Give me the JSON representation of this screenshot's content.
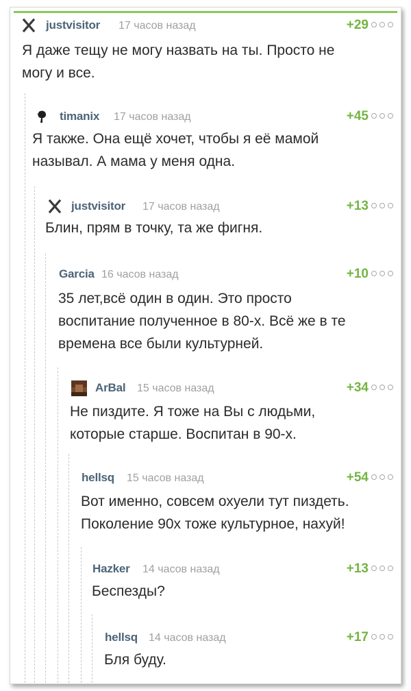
{
  "comments": [
    {
      "author": "justvisitor",
      "time": "17 часов назад",
      "rating": "+29",
      "text_lines": [
        "Я даже тещу не могу назвать на ты. Просто не",
        "могу и все."
      ],
      "avatar": "x-icon"
    },
    {
      "author": "timanix",
      "time": "17 часов назад",
      "rating": "+45",
      "text_lines": [
        "Я также. Она ещё хочет, чтобы я её мамой",
        "называл. А мама у меня одна."
      ],
      "avatar": "user-avatar-dark"
    },
    {
      "author": "justvisitor",
      "time": "17 часов назад",
      "rating": "+13",
      "text_lines": [
        "Блин, прям в точку, та же фигня."
      ],
      "avatar": "x-icon"
    },
    {
      "author": "Garcia",
      "time": "16 часов назад",
      "rating": "+10",
      "text_lines": [
        "35 лет,всё один в один. Это просто",
        "воспитание полученное в 80-х. Всё же в те",
        "времена все были культурней."
      ],
      "avatar": ""
    },
    {
      "author": "ArBal",
      "time": "15 часов назад",
      "rating": "+34",
      "text_lines": [
        "Не пиздите. Я тоже на Вы с людьми,",
        "которые старше. Воспитан в 90-х."
      ],
      "avatar": "user-avatar-brown"
    },
    {
      "author": "hellsq",
      "time": "15 часов назад",
      "rating": "+54",
      "text_lines": [
        "Вот именно, совсем охуели тут пиздеть.",
        "Поколение 90х тоже культурное, нахуй!"
      ],
      "avatar": ""
    },
    {
      "author": "Hazker",
      "time": "14 часов назад",
      "rating": "+13",
      "text_lines": [
        "Беспезды?"
      ],
      "avatar": ""
    },
    {
      "author": "hellsq",
      "time": "14 часов назад",
      "rating": "+17",
      "text_lines": [
        "Бля буду."
      ],
      "avatar": ""
    }
  ],
  "colors": {
    "accent_green": "#74b443",
    "author_color": "#4c6478",
    "time_color": "#a0a0a0",
    "text_color": "#2b2b2b"
  }
}
